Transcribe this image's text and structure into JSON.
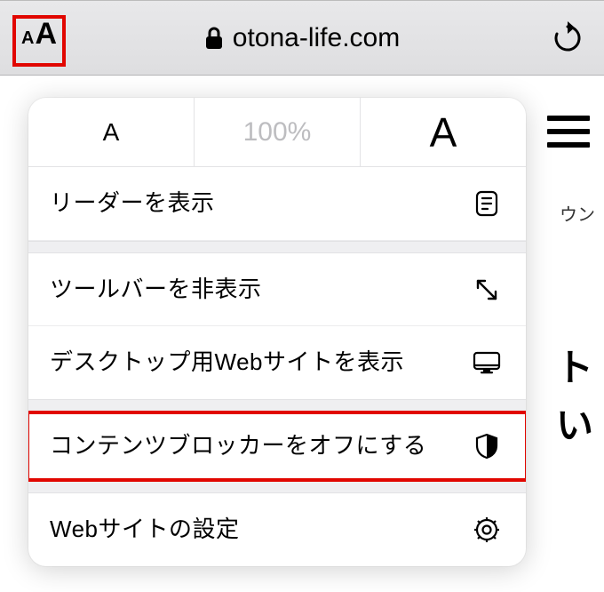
{
  "addressBar": {
    "aa_small": "A",
    "aa_big": "A",
    "domain": "otona-life.com"
  },
  "popover": {
    "zoom": {
      "smaller": "A",
      "percent": "100%",
      "bigger": "A"
    },
    "items": {
      "reader": "リーダーを表示",
      "hideToolbar": "ツールバーを非表示",
      "desktopSite": "デスクトップ用Webサイトを表示",
      "contentBlockerOff": "コンテンツブロッカーをオフにする",
      "siteSettings": "Webサイトの設定"
    }
  },
  "background": {
    "frag1": "ウン",
    "frag2": "ト",
    "frag3": "い"
  }
}
